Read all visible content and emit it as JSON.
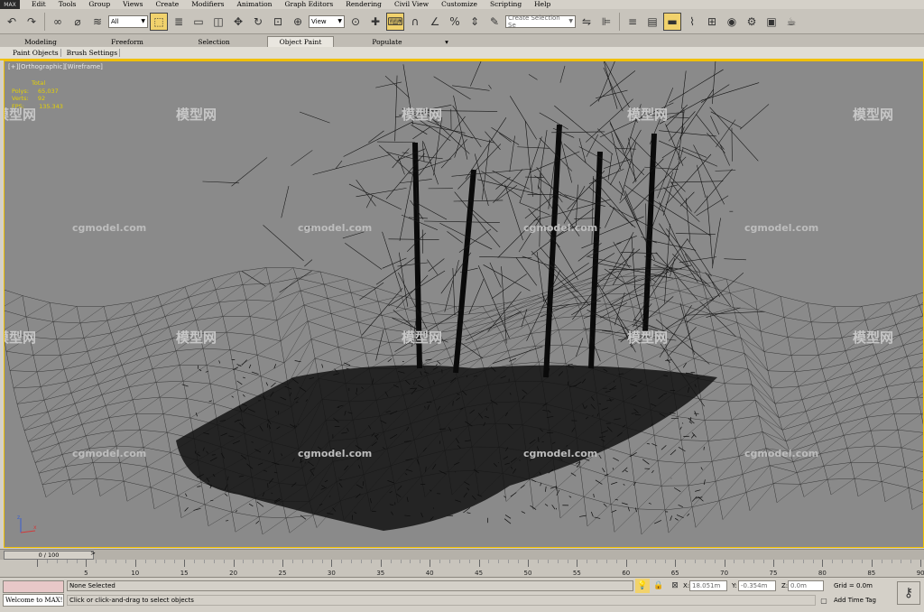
{
  "app": {
    "logo": "MAX"
  },
  "menu": [
    "Edit",
    "Tools",
    "Group",
    "Views",
    "Create",
    "Modifiers",
    "Animation",
    "Graph Editors",
    "Rendering",
    "Civil View",
    "Customize",
    "Scripting",
    "Help"
  ],
  "toolbar": {
    "filter_dropdown": "All",
    "refcoord_dropdown": "View",
    "selection_set_placeholder": "Create Selection Se",
    "icons": [
      "undo-icon",
      "redo-icon",
      "link-icon",
      "unlink-icon",
      "bind-spacewarp-icon",
      "select-object-icon",
      "select-by-name-icon",
      "rectangle-region-icon",
      "window-crossing-icon",
      "select-move-icon",
      "select-rotate-icon",
      "select-scale-icon",
      "use-pivot-icon",
      "select-manipulate-icon",
      "keyboard-shortcut-icon",
      "snaps-toggle-icon",
      "angle-snap-icon",
      "percent-snap-icon",
      "spinner-snap-icon",
      "edit-named-selection-icon",
      "mirror-icon",
      "align-icon",
      "layer-manager-icon",
      "graphite-ribbon-icon",
      "curve-editor-icon",
      "schematic-view-icon",
      "material-editor-icon",
      "render-setup-icon",
      "rendered-frame-icon",
      "render-production-icon"
    ]
  },
  "ribbon": {
    "tabs": [
      {
        "label": "Modeling",
        "active": false
      },
      {
        "label": "Freeform",
        "active": false
      },
      {
        "label": "Selection",
        "active": false
      },
      {
        "label": "Object Paint",
        "active": true
      },
      {
        "label": "Populate",
        "active": false
      }
    ],
    "subtabs": [
      "Paint Objects",
      "Brush Settings"
    ]
  },
  "viewport": {
    "label": "[+][Orthographic][Wireframe]",
    "stats": {
      "total_label": "Total",
      "polys_label": "Polys:",
      "polys_value": "65,037",
      "verts_label": "Verts:",
      "verts_value": "92",
      "fps_label": "FPS:",
      "fps_value": "135.343"
    },
    "watermark_text": "cgmodel.com",
    "watermark_logo": "模型网"
  },
  "timeline": {
    "frame_display": "0 / 100",
    "next_arrow": ">",
    "ticks": [
      "5",
      "10",
      "15",
      "20",
      "25",
      "30",
      "35",
      "40",
      "45",
      "50",
      "55",
      "60",
      "65",
      "70",
      "75",
      "80",
      "85",
      "90"
    ]
  },
  "status": {
    "maxscript_listener": "Welcome to MAX!",
    "selection": "None Selected",
    "prompt": "Click or click-and-drag to select objects",
    "x_label": "X:",
    "x_value": "18.051m",
    "y_label": "Y:",
    "y_value": "-0.354m",
    "z_label": "Z:",
    "z_value": "0.0m",
    "grid": "Grid = 0.0m",
    "add_time_tag": "Add Time Tag",
    "accent": "#f0c000"
  }
}
